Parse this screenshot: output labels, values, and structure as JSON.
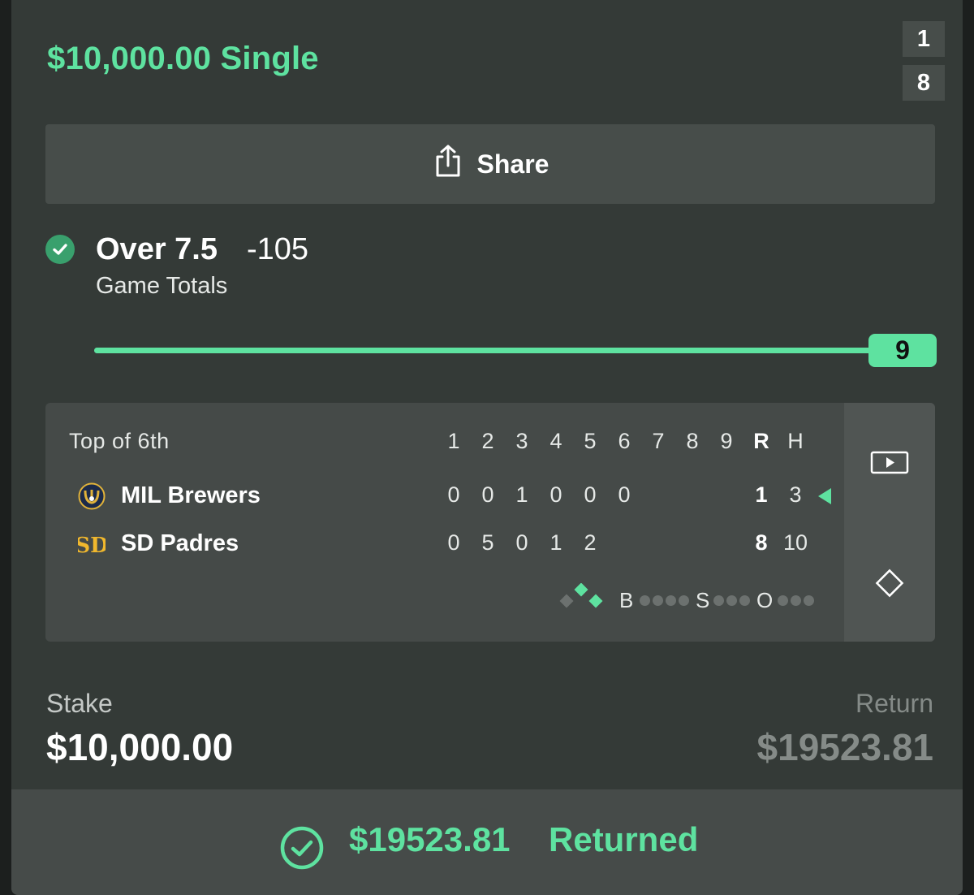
{
  "bet": {
    "title": "$10,000.00 Single",
    "score_top": "1",
    "score_bottom": "8",
    "share_label": "Share"
  },
  "selection": {
    "name": "Over 7.5",
    "odds": "-105",
    "market": "Game Totals",
    "progress_value": "9",
    "progress_fraction": 1.0
  },
  "scoreboard": {
    "status": "Top of 6th",
    "innings": [
      "1",
      "2",
      "3",
      "4",
      "5",
      "6",
      "7",
      "8",
      "9"
    ],
    "runs_header": "R",
    "hits_header": "H",
    "teams": [
      {
        "name": "MIL Brewers",
        "innings": [
          "0",
          "0",
          "1",
          "0",
          "0",
          "0",
          "",
          "",
          ""
        ],
        "runs": "1",
        "hits": "3",
        "batting": true,
        "logo": "brewers-logo-icon"
      },
      {
        "name": "SD Padres",
        "innings": [
          "0",
          "5",
          "0",
          "1",
          "2",
          "",
          "",
          "",
          ""
        ],
        "runs": "8",
        "hits": "10",
        "batting": false,
        "logo": "padres-logo-icon"
      }
    ],
    "count": {
      "balls_label": "B",
      "strikes_label": "S",
      "outs_label": "O",
      "balls": 0,
      "strikes": 0,
      "outs": 0
    }
  },
  "totals": {
    "stake_label": "Stake",
    "stake_value": "$10,000.00",
    "return_label": "Return",
    "return_value": "$19523.81"
  },
  "footer": {
    "amount": "$19523.81",
    "status": "Returned"
  },
  "colors": {
    "accent": "#5ee2a0",
    "card": "#343a37",
    "panel": "#474d4a"
  }
}
